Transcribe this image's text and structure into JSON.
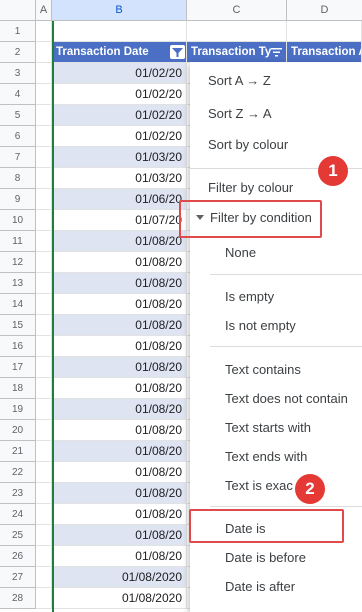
{
  "columns": [
    "A",
    "B",
    "C",
    "D"
  ],
  "rows": [
    "1",
    "2",
    "3",
    "4",
    "5",
    "6",
    "7",
    "8",
    "9",
    "10",
    "11",
    "12",
    "13",
    "14",
    "15",
    "16",
    "17",
    "18",
    "19",
    "20",
    "21",
    "22",
    "23",
    "24",
    "25",
    "26",
    "27",
    "28"
  ],
  "table": {
    "headers": [
      "Transaction Date",
      "Transaction Ty",
      "Transaction A"
    ],
    "dates": [
      "01/02/20",
      "01/02/20",
      "01/02/20",
      "01/02/20",
      "01/03/20",
      "01/03/20",
      "01/06/20",
      "01/07/20",
      "01/08/20",
      "01/08/20",
      "01/08/20",
      "01/08/20",
      "01/08/20",
      "01/08/20",
      "01/08/20",
      "01/08/20",
      "01/08/20",
      "01/08/20",
      "01/08/20",
      "01/08/20",
      "01/08/20",
      "01/08/20",
      "01/08/20",
      "01/08/20",
      "01/08/2020",
      "01/08/2020"
    ]
  },
  "menu": {
    "sort_az": "Sort A → Z",
    "sort_za": "Sort Z → A",
    "sort_colour": "Sort by colour",
    "filter_colour": "Filter by colour",
    "filter_condition": "Filter by condition"
  },
  "conditions": [
    "None",
    "Is empty",
    "Is not empty",
    "Text contains",
    "Text does not contain",
    "Text starts with",
    "Text ends with",
    "Text is exac",
    "Date is",
    "Date is before",
    "Date is after"
  ],
  "annotations": {
    "badge1": "1",
    "badge2": "2"
  },
  "colors": {
    "header_blue": "#4a6fc4",
    "stripe": "#dfe4f3",
    "annotation_red": "#e53935"
  }
}
